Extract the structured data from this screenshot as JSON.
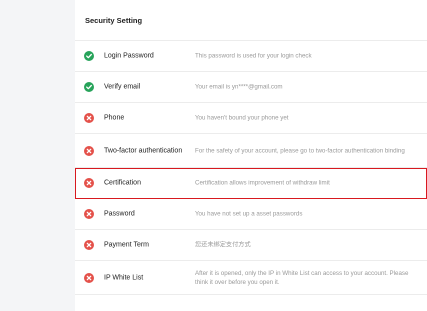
{
  "header": {
    "title": "Security Setting"
  },
  "colors": {
    "ok": "#27a35a",
    "error": "#e4514a",
    "highlight": "#d8191f"
  },
  "items": [
    {
      "label": "Login Password",
      "status": "ok",
      "icon": "check-circle-icon",
      "description": "This password is used for your login check"
    },
    {
      "label": "Verify email",
      "status": "ok",
      "icon": "check-circle-icon",
      "description": "Your email is yn****@gmail.com"
    },
    {
      "label": "Phone",
      "status": "error",
      "icon": "x-circle-icon",
      "description": "You haven't bound your phone yet"
    },
    {
      "label": "Two-factor authentication",
      "status": "error",
      "icon": "x-circle-icon",
      "description": "For the safety of your account, please go to two-factor authentication binding"
    },
    {
      "label": "Certification",
      "status": "error",
      "icon": "x-circle-icon",
      "description": "Certification allows improvement of withdraw limit"
    },
    {
      "label": "Password",
      "status": "error",
      "icon": "x-circle-icon",
      "description": "You have not set up a asset passwords"
    },
    {
      "label": "Payment Term",
      "status": "error",
      "icon": "x-circle-icon",
      "description": "您还未绑定支付方式"
    },
    {
      "label": "IP White List",
      "status": "error",
      "icon": "x-circle-icon",
      "description": "After it is opened, only the IP in White List can access to your account. Please think it over before you open it."
    }
  ]
}
